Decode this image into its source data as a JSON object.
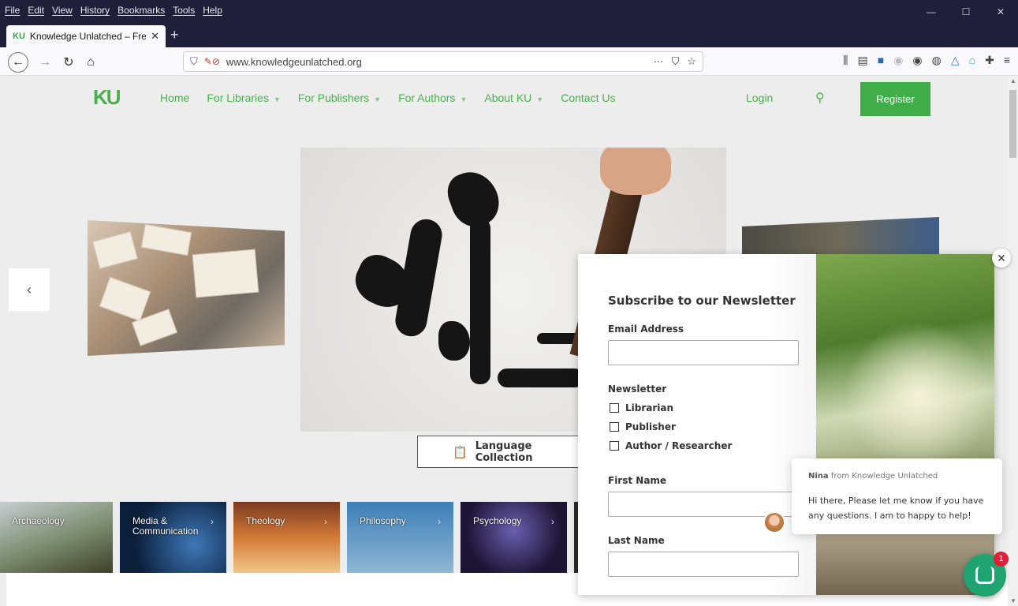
{
  "browser": {
    "menus": [
      "File",
      "Edit",
      "View",
      "History",
      "Bookmarks",
      "Tools",
      "Help"
    ],
    "window_controls": {
      "minimize": "—",
      "maximize": "☐",
      "close": "✕"
    },
    "tab": {
      "favicon": "KU",
      "title": "Knowledge Unlatched – Free a",
      "close": "✕"
    },
    "new_tab": "+",
    "url": "www.knowledgeunlatched.org",
    "url_actions": [
      "···",
      "⛉",
      "☆"
    ]
  },
  "site": {
    "logo": "KU",
    "nav": [
      {
        "label": "Home",
        "caret": false
      },
      {
        "label": "For Libraries",
        "caret": true
      },
      {
        "label": "For Publishers",
        "caret": true
      },
      {
        "label": "For Authors",
        "caret": true
      },
      {
        "label": "About KU",
        "caret": true
      },
      {
        "label": "Contact Us",
        "caret": false
      }
    ],
    "login": "Login",
    "register": "Register",
    "carousel_prev": "‹",
    "language_button": "Language Collection",
    "subjects": [
      {
        "label": "Archaeology",
        "chevron": "›"
      },
      {
        "label": "Media &\nCommunication",
        "chevron": "›"
      },
      {
        "label": "Theology",
        "chevron": "›"
      },
      {
        "label": "Philosophy",
        "chevron": "›"
      },
      {
        "label": "Psychology",
        "chevron": "›"
      }
    ]
  },
  "newsletter": {
    "title": "Subscribe to our Newsletter",
    "email_label": "Email Address",
    "email_value": "",
    "newsletter_label": "Newsletter",
    "options": [
      "Librarian",
      "Publisher",
      "Author / Researcher"
    ],
    "first_name_label": "First Name",
    "first_name_value": "",
    "last_name_label": "Last Name",
    "last_name_value": "",
    "close": "✕"
  },
  "chat": {
    "agent_name": "Nina",
    "agent_from": " from Knowledge Unlatched",
    "message": "Hi there, Please let me know if you have any questions. I am to happy to help!",
    "badge_count": "1"
  },
  "colors": {
    "brand_green": "#4cae4f",
    "register_green": "#3fae49",
    "chat_green": "#1fa471",
    "badge_red": "#e0213a",
    "titlebar": "#1f1f3a"
  }
}
